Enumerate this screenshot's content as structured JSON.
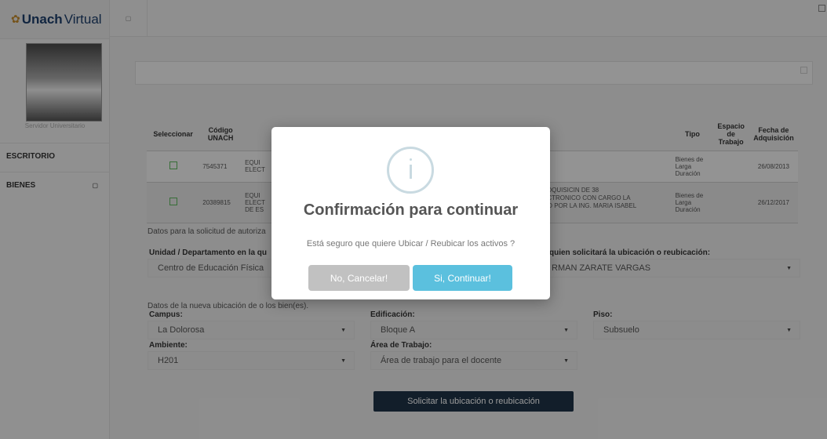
{
  "logo": {
    "brand": "Unach",
    "suffix": "Virtual"
  },
  "profile": {
    "role": "Servidor Universitario"
  },
  "nav": {
    "items": [
      {
        "label": "ESCRITORIO"
      },
      {
        "label": "BIENES"
      }
    ]
  },
  "table": {
    "headers": [
      "Seleccionar",
      "Código UNACH",
      "Tipo",
      "Espacio de Trabajo",
      "Fecha de Adquisición"
    ],
    "rows": [
      {
        "code": "7545371",
        "desc": "EQUI\nELECT",
        "detail": "",
        "tipo": "Bienes de Larga Duración",
        "fecha": "26/08/2013"
      },
      {
        "code": "20389815",
        "desc": "EQUI\nELECT\nDE ES",
        "detail": "ADQUISICIN DE 38\nECTRONICO CON CARGO LA\nDO POR LA ING. MARIA ISABEL",
        "tipo": "Bienes de Larga Duración",
        "fecha": "26/12/2017"
      }
    ]
  },
  "form": {
    "auth_note": "Datos para la solicitud de autoriza",
    "unit_label": "Unidad / Departamento en la qu",
    "unit_value": "Centro de Educación Física",
    "requester_label": "quien solicitará la ubicación o reubicación:",
    "requester_value": "RMAN ZARATE VARGAS",
    "new_loc_note": "Datos de la nueva ubicación de o los bien(es).",
    "campus_label": "Campus:",
    "campus_value": "La Dolorosa",
    "building_label": "Edificación:",
    "building_value": "Bloque A",
    "floor_label": "Piso:",
    "floor_value": "Subsuelo",
    "room_label": "Ambiente:",
    "room_value": "H201",
    "area_label": "Área de Trabajo:",
    "area_value": "Área de trabajo para el docente",
    "submit_label": "Solicitar la ubicación o reubicación"
  },
  "modal": {
    "title": "Confirmación para continuar",
    "message": "Está seguro que quiere Ubicar / Reubicar los activos ?",
    "cancel_label": "No, Cancelar!",
    "confirm_label": "Si, Continuar!"
  }
}
